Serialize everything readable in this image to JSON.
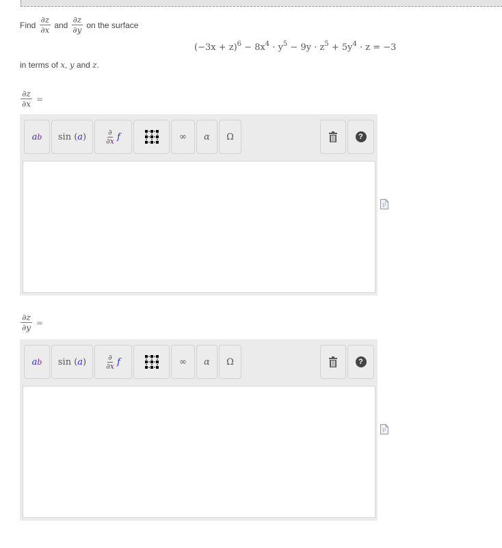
{
  "prompt": {
    "find": "Find",
    "and": "and",
    "on_surface": "on the surface",
    "dz_dx": {
      "num": "∂z",
      "den": "∂x"
    },
    "dz_dy": {
      "num": "∂z",
      "den": "∂y"
    }
  },
  "equation": {
    "part1": "(−3x + z)",
    "exp1": "6",
    "part2": " − 8x",
    "exp2": "4",
    "part3": " · y",
    "exp3": "5",
    "part4": " − 9y · z",
    "exp4": "5",
    "part5": " + 5y",
    "exp5": "4",
    "part6": " · z = −3"
  },
  "terms": {
    "prefix": "in terms of ",
    "x": "x",
    "sep1": ", ",
    "y": "y",
    "sep2": " and ",
    "z": "z",
    "suffix": "."
  },
  "answers": [
    {
      "label_num": "∂z",
      "label_den": "∂x",
      "equals": "=",
      "value": ""
    },
    {
      "label_num": "∂z",
      "label_den": "∂y",
      "equals": "=",
      "value": ""
    }
  ],
  "toolbar": {
    "power": {
      "base": "a",
      "exp": "b",
      "icon": "superscript-icon"
    },
    "function": {
      "fn": "sin",
      "arg": "a",
      "icon": "function-icon"
    },
    "derivative": {
      "num": "∂",
      "den_d": "∂",
      "den_x": "x",
      "f": "f",
      "icon": "partial-derivative-icon"
    },
    "matrix": {
      "icon": "matrix-icon"
    },
    "infinity": "∞",
    "alpha": "α",
    "omega": "Ω",
    "trash": {
      "icon": "trash-icon"
    },
    "help": "?"
  },
  "doc_icon_letter": "P",
  "colors": {
    "toolbar_bg": "#ebebeb",
    "blue_var": "#2a2adf",
    "purple_var": "#7a1f7a"
  }
}
